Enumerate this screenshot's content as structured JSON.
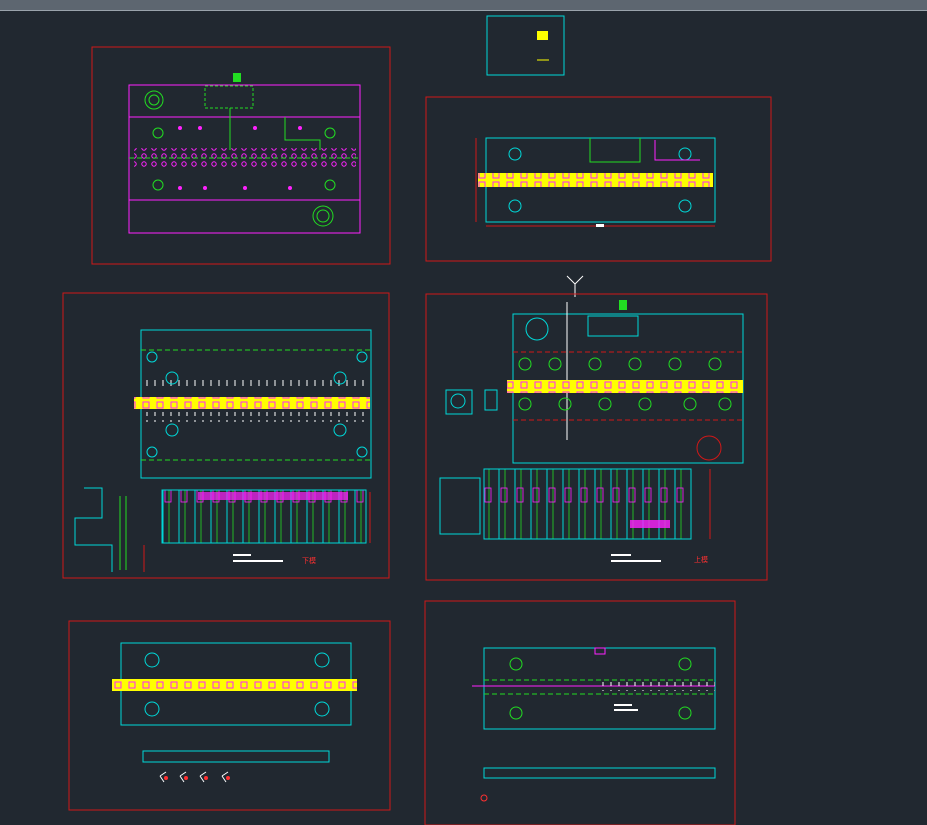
{
  "window": {
    "title": ""
  },
  "colors": {
    "background": "#212830",
    "frame": "#d01818",
    "plate": "#00d8d8",
    "magenta": "#ff22ff",
    "yellow": "#ffff00",
    "green": "#22dd22",
    "white": "#ffffff",
    "red": "#ff3030"
  },
  "labels": {
    "lower_die": "下模",
    "upper_die": "上模"
  },
  "drawing": {
    "sheets": [
      "top-left-sheet",
      "top-right-sheet",
      "mid-left-sheet",
      "mid-right-sheet",
      "bottom-left-sheet",
      "bottom-right-sheet"
    ],
    "ucs_icon": "ucs-axis-icon"
  }
}
